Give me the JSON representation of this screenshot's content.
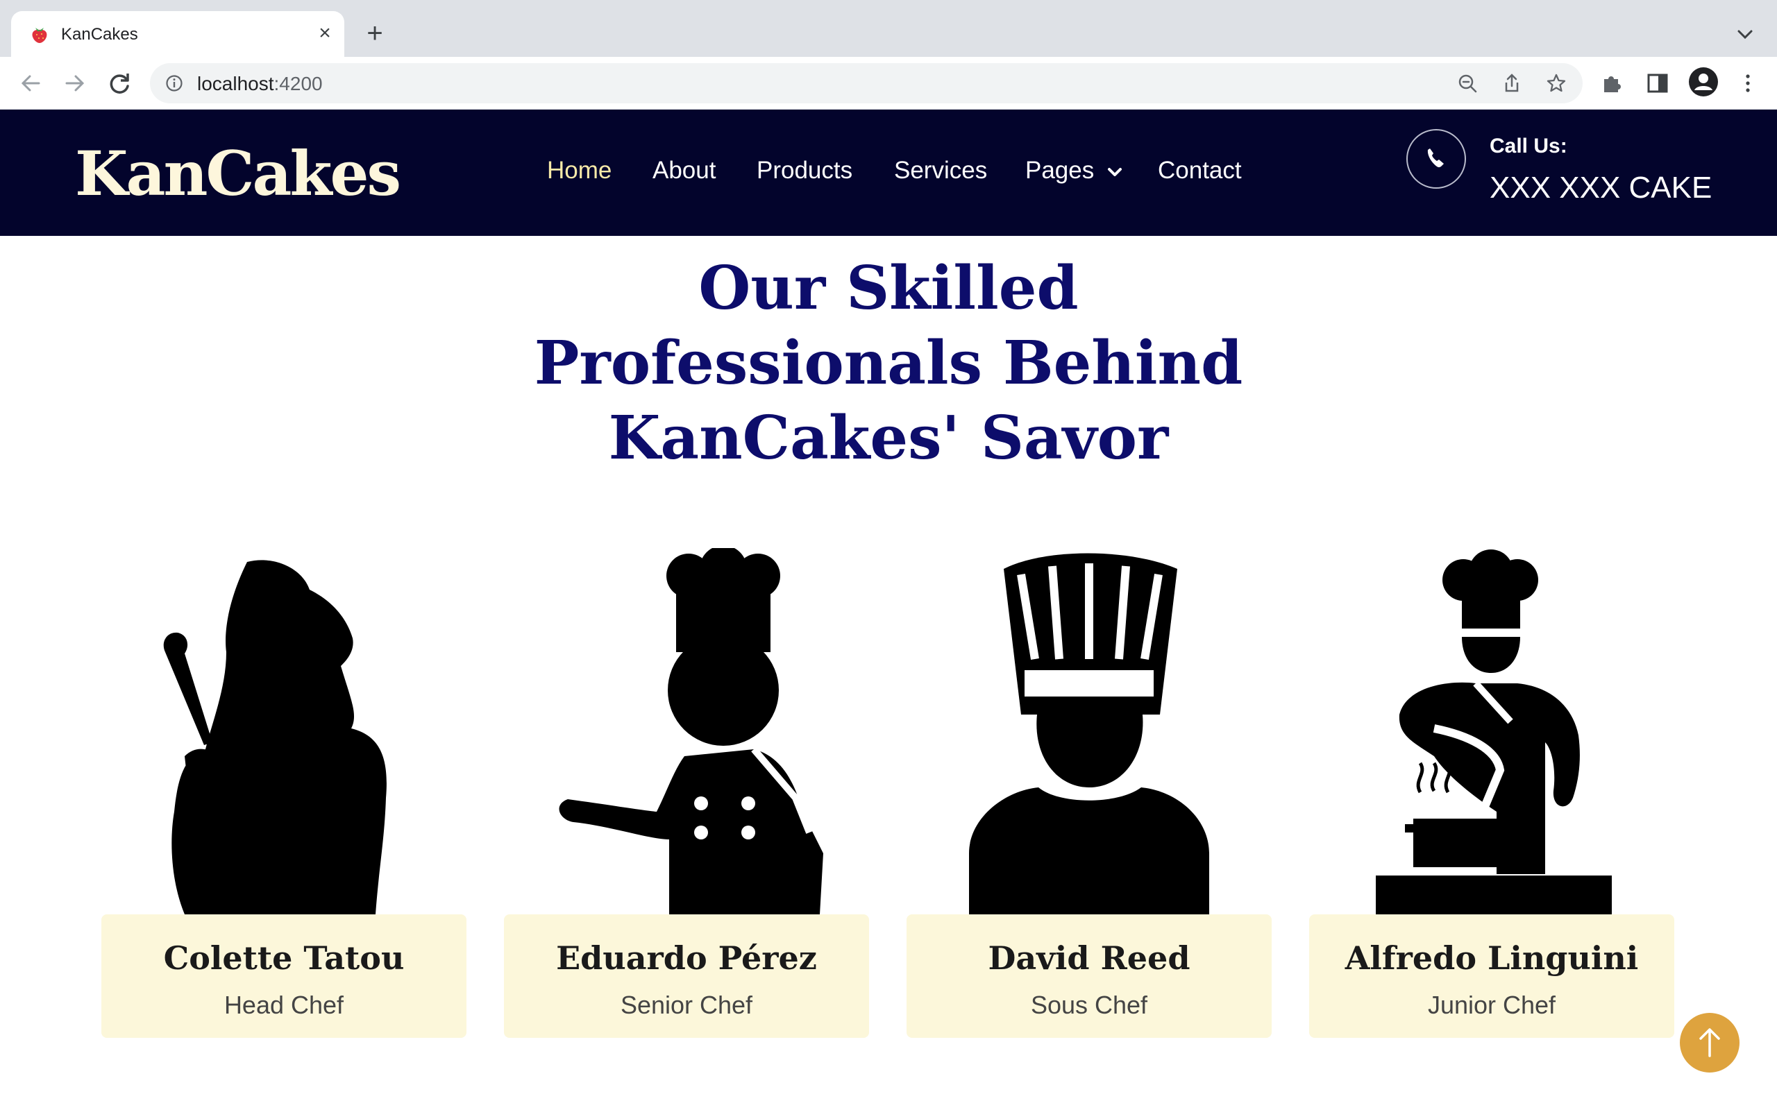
{
  "browser": {
    "tab_title": "KanCakes",
    "url_host": "localhost",
    "url_port": ":4200"
  },
  "site": {
    "logo": "KanCakes",
    "nav": [
      "Home",
      "About",
      "Products",
      "Services",
      "Pages",
      "Contact"
    ],
    "active_nav": "Home",
    "call_label": "Call Us:",
    "call_number": "XXX XXX CAKE"
  },
  "section": {
    "title_lines": [
      "Our Skilled",
      "Professionals Behind",
      "KanCakes' Savor"
    ]
  },
  "team": [
    {
      "name": "Colette Tatou",
      "role": "Head Chef",
      "icon": "female-chef-with-spoon-icon"
    },
    {
      "name": "Eduardo Pérez",
      "role": "Senior Chef",
      "icon": "chef-pointing-icon"
    },
    {
      "name": "David Reed",
      "role": "Sous Chef",
      "icon": "chef-bust-icon"
    },
    {
      "name": "Alfredo Linguini",
      "role": "Junior Chef",
      "icon": "chef-cooking-pot-icon"
    }
  ],
  "colors": {
    "header_bg": "#03042c",
    "logo": "#fdf6dc",
    "active_nav": "#f7e9a8",
    "heading": "#0d0d6b",
    "card_bg": "#fcf7da",
    "back_to_top": "#dea33e"
  },
  "icons": {
    "back_to_top": "arrow-up-icon",
    "phone": "phone-icon"
  }
}
